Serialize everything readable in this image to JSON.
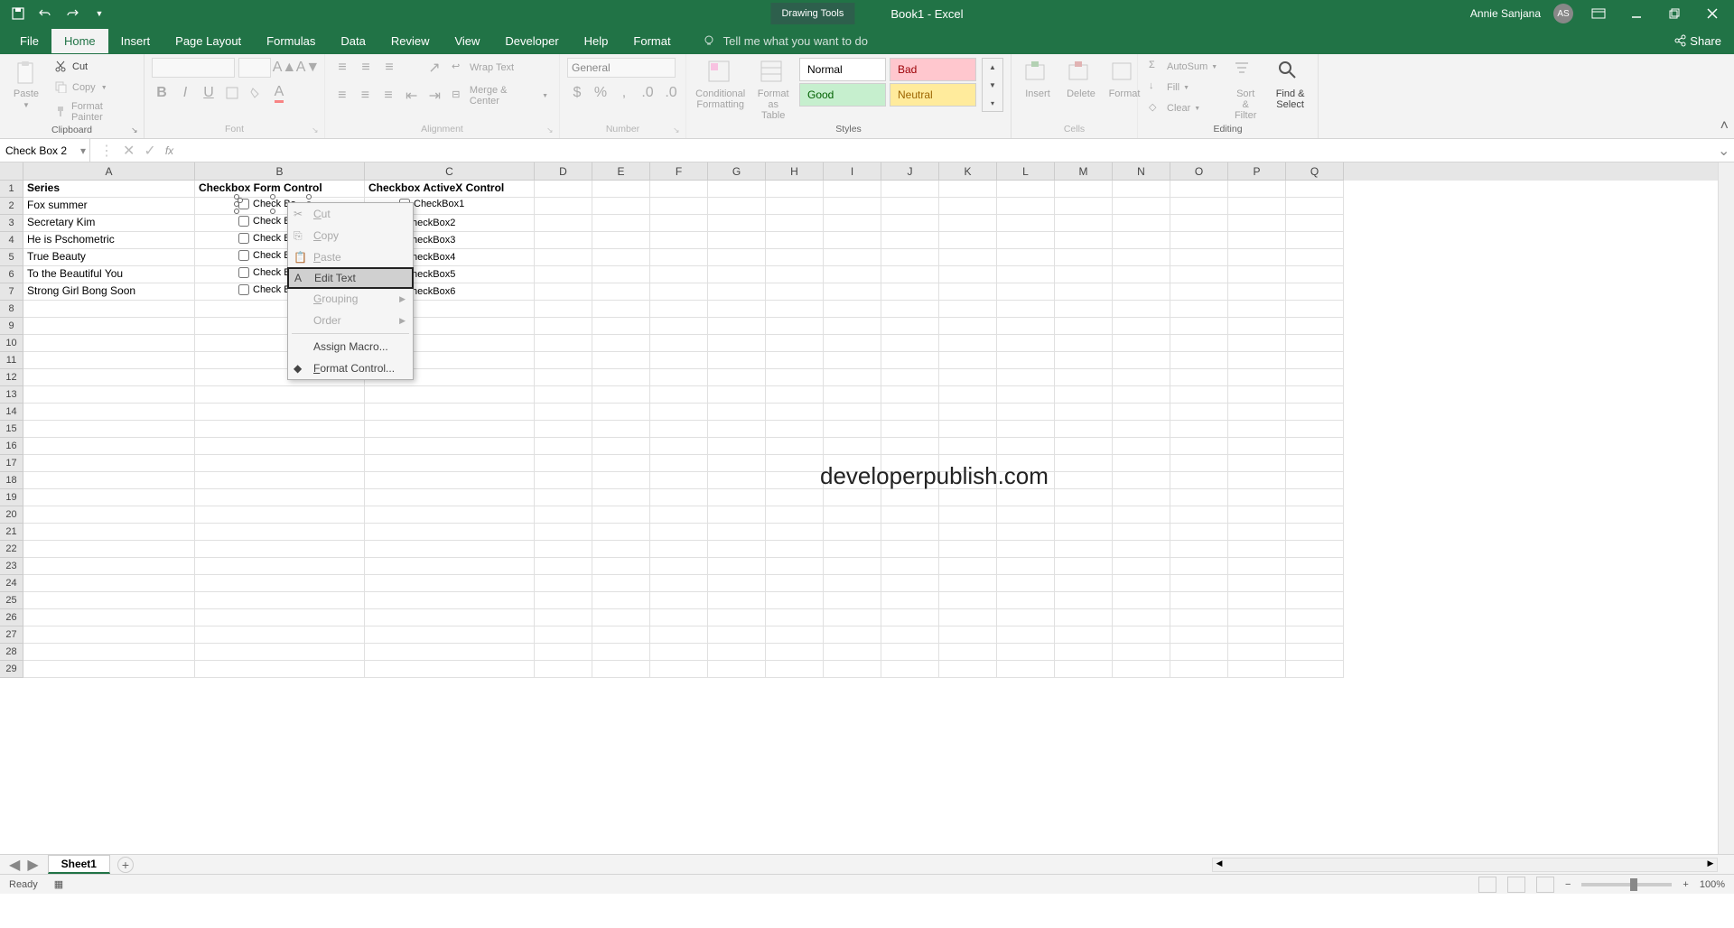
{
  "titlebar": {
    "drawing_tools": "Drawing Tools",
    "doc_title": "Book1  -  Excel",
    "user_name": "Annie Sanjana",
    "user_initials": "AS"
  },
  "tabs": {
    "file": "File",
    "home": "Home",
    "insert": "Insert",
    "page_layout": "Page Layout",
    "formulas": "Formulas",
    "data": "Data",
    "review": "Review",
    "view": "View",
    "developer": "Developer",
    "help": "Help",
    "format": "Format",
    "tellme": "Tell me what you want to do",
    "share": "Share"
  },
  "ribbon": {
    "clipboard": {
      "paste": "Paste",
      "cut": "Cut",
      "copy": "Copy",
      "format_painter": "Format Painter",
      "label": "Clipboard"
    },
    "font": {
      "label": "Font"
    },
    "alignment": {
      "wrap_text": "Wrap Text",
      "merge_center": "Merge & Center",
      "label": "Alignment"
    },
    "number": {
      "general": "General",
      "label": "Number"
    },
    "styles": {
      "conditional": "Conditional Formatting",
      "format_as": "Format as Table",
      "normal": "Normal",
      "bad": "Bad",
      "good": "Good",
      "neutral": "Neutral",
      "label": "Styles"
    },
    "cells": {
      "insert": "Insert",
      "delete": "Delete",
      "format": "Format",
      "label": "Cells"
    },
    "editing": {
      "autosum": "AutoSum",
      "fill": "Fill",
      "clear": "Clear",
      "sort_filter": "Sort & Filter",
      "find_select": "Find & Select",
      "label": "Editing"
    }
  },
  "namebox": "Check Box 2",
  "columns": [
    "A",
    "B",
    "C",
    "D",
    "E",
    "F",
    "G",
    "H",
    "I",
    "J",
    "K",
    "L",
    "M",
    "N",
    "O",
    "P",
    "Q"
  ],
  "grid": {
    "headers": {
      "a1": "Series",
      "b1": "Checkbox Form Control",
      "c1": "Checkbox ActiveX Control"
    },
    "series": [
      "Fox summer",
      "Secretary Kim",
      "He is Pschometric",
      "True Beauty",
      "To the Beautiful You",
      "Strong Girl Bong Soon"
    ],
    "form_checks": [
      "Check Bo",
      "Check Bo",
      "Check Bo",
      "Check Bo",
      "Check Bo",
      "Check Bo"
    ],
    "activex_checks": [
      "CheckBox1",
      "heckBox2",
      "heckBox3",
      "heckBox4",
      "heckBox5",
      "heckBox6"
    ]
  },
  "watermark": "developerpublish.com",
  "context_menu": {
    "cut": "Cut",
    "copy": "Copy",
    "paste": "Paste",
    "edit_text": "Edit Text",
    "grouping": "Grouping",
    "order": "Order",
    "assign_macro": "Assign Macro...",
    "format_control": "Format Control..."
  },
  "sheet": {
    "sheet1": "Sheet1"
  },
  "status": {
    "ready": "Ready",
    "zoom": "100%"
  }
}
